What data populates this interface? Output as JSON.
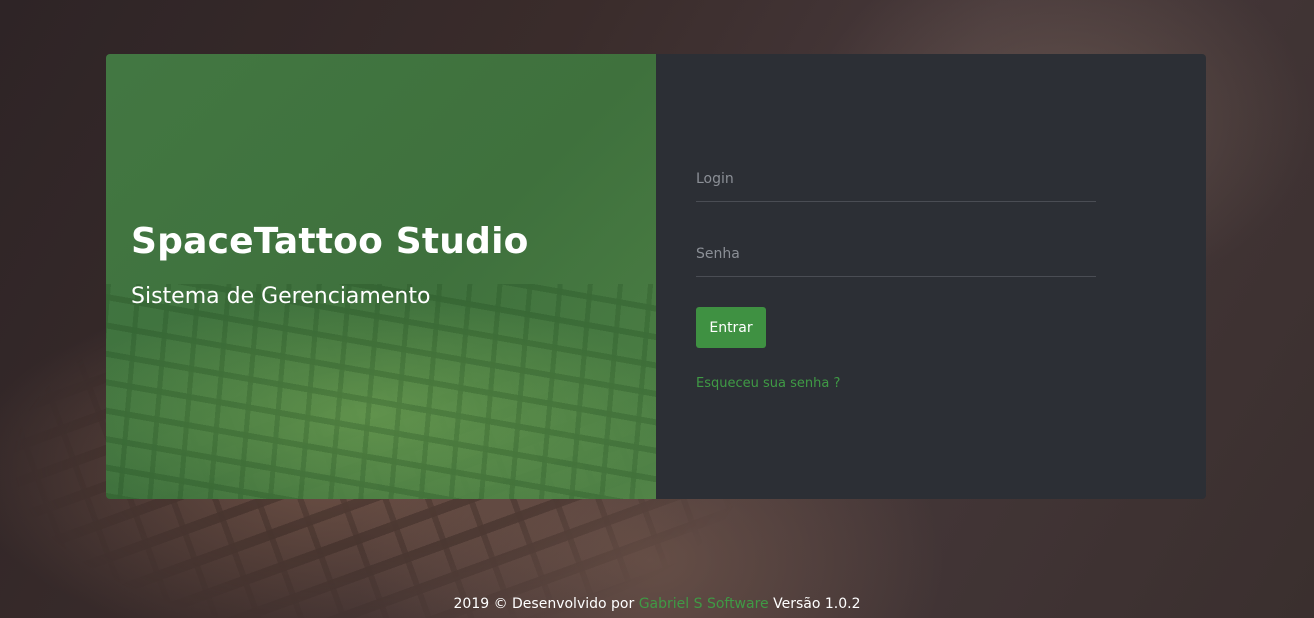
{
  "brand": {
    "title": "SpaceTattoo Studio",
    "subtitle": "Sistema de Gerenciamento"
  },
  "login_form": {
    "login_placeholder": "Login",
    "login_value": "",
    "password_placeholder": "Senha",
    "password_value": "",
    "submit_label": "Entrar",
    "forgot_link": "Esqueceu sua senha ?"
  },
  "footer": {
    "prefix": "2019 © Desenvolvido por ",
    "developer": "Gabriel S Software",
    "suffix": " Versão 1.0.2"
  },
  "colors": {
    "accent": "#3f9142",
    "panel_left": "#437a43",
    "panel_right": "#2c2f35"
  }
}
